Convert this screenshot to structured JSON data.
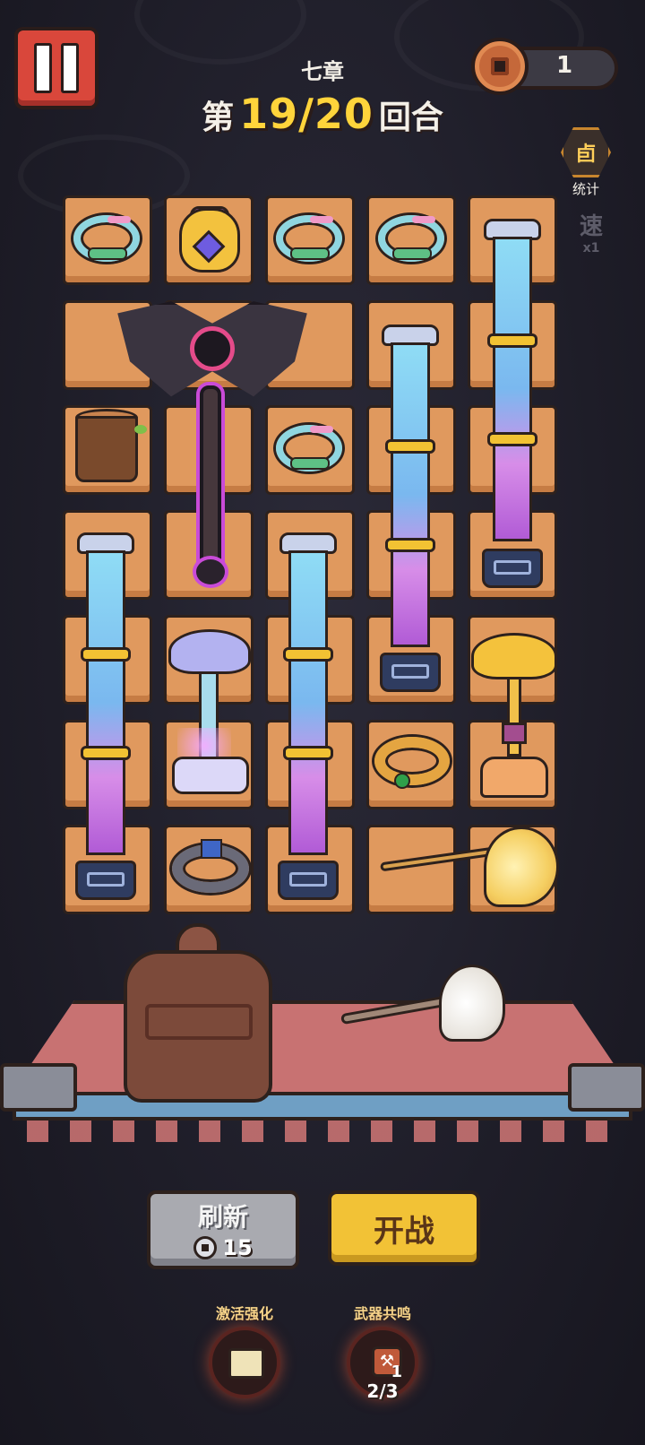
{
  "header": {
    "chapter": "七章",
    "round_prefix": "第",
    "round_current_total": "19/20",
    "round_suffix": "回合",
    "coins": "1"
  },
  "side": {
    "stats_icon": "卣",
    "stats_label": "统计",
    "speed_label": "速",
    "speed_multiplier": "x1"
  },
  "grid_items": [
    "jade-ring",
    "treasure-bag",
    "jade-ring",
    "jade-ring",
    "cloud-pillar",
    "shadow-axe",
    "tree-stump",
    "jade-ring",
    "cloud-pillar",
    "cloud-pillar",
    "cloud-pillar",
    "lotus-lamp",
    "golden-lotus-lamp",
    "golden-bangle",
    "dark-bangle",
    "golden-whisk"
  ],
  "bench_items": [
    "bronze-urn",
    "white-whisk"
  ],
  "buttons": {
    "refresh_label": "刷新",
    "refresh_cost": "15",
    "fight_label": "开战"
  },
  "skills": {
    "activate_label": "激活强化",
    "resonance_label": "武器共鸣",
    "resonance_badge": "1",
    "resonance_count": "2/3"
  },
  "colors": {
    "tile": "#e0995e",
    "accent_yellow": "#ffd43b",
    "pause_red": "#d9473b",
    "fight_yellow": "#f2c236"
  }
}
